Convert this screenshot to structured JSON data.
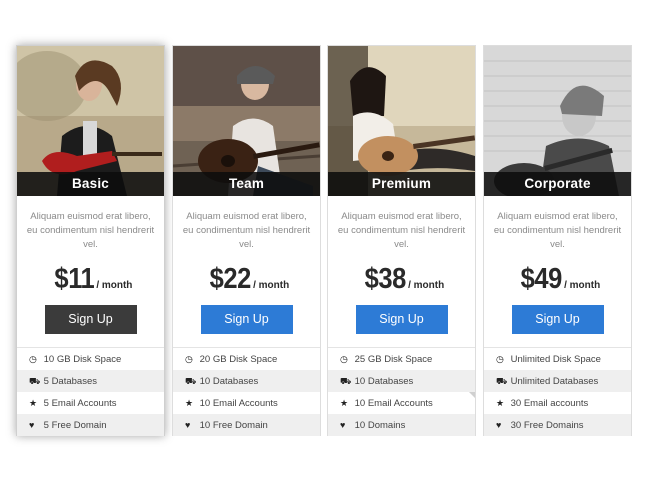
{
  "plans": [
    {
      "name": "Basic",
      "description": "Aliquam euismod erat libero, eu condimentum nisl hendrerit vel.",
      "price": "$11",
      "period": "/ month",
      "button": "Sign Up",
      "featured": true,
      "features": [
        {
          "icon": "clock-icon",
          "glyph": "◷",
          "text": "10 GB Disk Space"
        },
        {
          "icon": "cart-icon",
          "glyph": "⛟",
          "text": "5 Databases"
        },
        {
          "icon": "star-icon",
          "glyph": "★",
          "text": "5 Email Accounts"
        },
        {
          "icon": "heart-icon",
          "glyph": "♥",
          "text": "5 Free Domain"
        }
      ]
    },
    {
      "name": "Team",
      "description": "Aliquam euismod erat libero, eu condimentum nisl hendrerit vel.",
      "price": "$22",
      "period": "/ month",
      "button": "Sign Up",
      "featured": false,
      "features": [
        {
          "icon": "clock-icon",
          "glyph": "◷",
          "text": "20 GB Disk Space"
        },
        {
          "icon": "cart-icon",
          "glyph": "⛟",
          "text": "10 Databases"
        },
        {
          "icon": "star-icon",
          "glyph": "★",
          "text": "10 Email Accounts"
        },
        {
          "icon": "heart-icon",
          "glyph": "♥",
          "text": "10 Free Domain"
        }
      ]
    },
    {
      "name": "Premium",
      "description": "Aliquam euismod erat libero, eu condimentum nisl hendrerit vel.",
      "price": "$38",
      "period": "/ month",
      "button": "Sign Up",
      "featured": false,
      "features": [
        {
          "icon": "clock-icon",
          "glyph": "◷",
          "text": "25 GB Disk Space"
        },
        {
          "icon": "cart-icon",
          "glyph": "⛟",
          "text": "10 Databases"
        },
        {
          "icon": "star-icon",
          "glyph": "★",
          "text": "10 Email Accounts"
        },
        {
          "icon": "heart-icon",
          "glyph": "♥",
          "text": "10 Domains"
        }
      ]
    },
    {
      "name": "Corporate",
      "description": "Aliquam euismod erat libero, eu condimentum nisl hendrerit vel.",
      "price": "$49",
      "period": "/ month",
      "button": "Sign Up",
      "featured": false,
      "features": [
        {
          "icon": "clock-icon",
          "glyph": "◷",
          "text": "Unlimited Disk Space"
        },
        {
          "icon": "cart-icon",
          "glyph": "⛟",
          "text": "Unlimited Databases"
        },
        {
          "icon": "star-icon",
          "glyph": "★",
          "text": "30 Email accounts"
        },
        {
          "icon": "heart-icon",
          "glyph": "♥",
          "text": "30 Free Domains"
        }
      ]
    }
  ],
  "colors": {
    "accent": "#2d7bd6",
    "featured_button": "#3b3b3b",
    "plan_bar": "#0c0c0c"
  }
}
